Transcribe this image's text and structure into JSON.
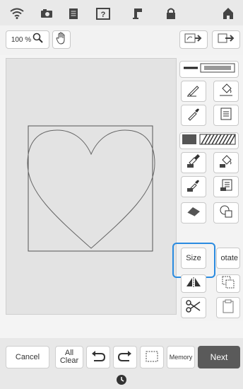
{
  "toolbar": {
    "zoom_label": "100 %"
  },
  "tools": {
    "size_label": "Size",
    "rotate_label": "otate"
  },
  "bottom": {
    "cancel_label": "Cancel",
    "allclear_line1": "All",
    "allclear_line2": "Clear",
    "memory_label": "Memory",
    "next_label": "Next"
  },
  "colors": {
    "accent": "#2a8be0",
    "next_bg": "#5a5a5a",
    "line_color": "#6b6b6b"
  },
  "icons": [
    "wifi-icon",
    "camera-icon",
    "document-icon",
    "help-icon",
    "embroidery-icon",
    "lock-icon",
    "home-icon",
    "zoom-icon",
    "hand-icon",
    "import-icon",
    "export-icon",
    "line-style-icon",
    "pen-icon",
    "bucket-icon",
    "eyedropper-icon",
    "list-icon",
    "fill-pattern-icon",
    "brush-icon",
    "bucket-fill-icon",
    "eyedropper-fill-icon",
    "list-fill-icon",
    "eraser-icon",
    "stamp-icon",
    "flip-icon",
    "copy-icon",
    "scissors-icon",
    "paste-icon",
    "undo-icon",
    "redo-icon",
    "select-icon",
    "clock-icon"
  ]
}
